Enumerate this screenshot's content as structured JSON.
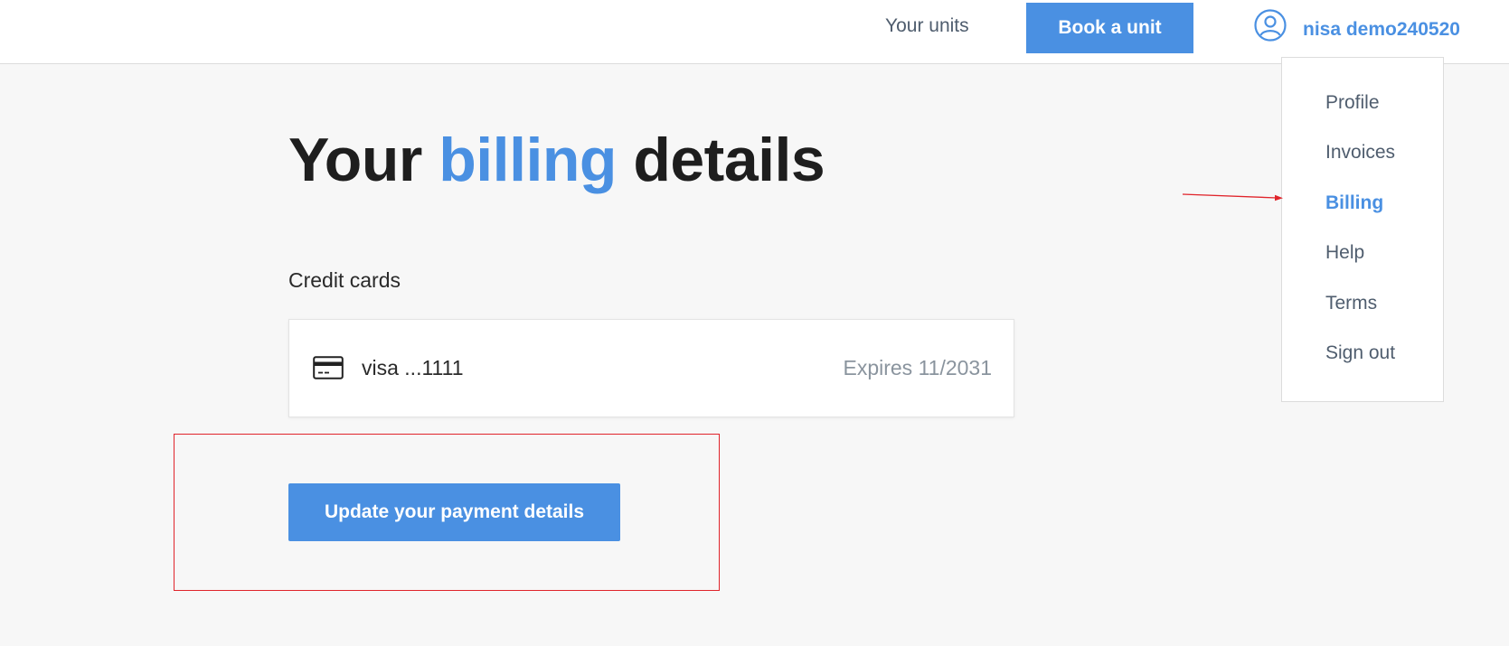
{
  "header": {
    "nav_your_units": "Your units",
    "book_button": "Book a unit",
    "user_name": "nisa demo240520",
    "user_icon": "user-circle-icon"
  },
  "menu": {
    "items": [
      {
        "label": "Profile",
        "active": false
      },
      {
        "label": "Invoices",
        "active": false
      },
      {
        "label": "Billing",
        "active": true
      },
      {
        "label": "Help",
        "active": false
      },
      {
        "label": "Terms",
        "active": false
      },
      {
        "label": "Sign out",
        "active": false
      }
    ]
  },
  "page": {
    "title_before": "Your ",
    "title_accent": "billing",
    "title_after": " details",
    "section_label": "Credit cards"
  },
  "card": {
    "icon": "credit-card-icon",
    "number": "visa ...1111",
    "expiry": "Expires 11/2031"
  },
  "actions": {
    "update_button": "Update your payment details"
  },
  "colors": {
    "accent": "#4a90e2",
    "annotation": "#e0242b",
    "text_muted": "#4f5d6e"
  }
}
